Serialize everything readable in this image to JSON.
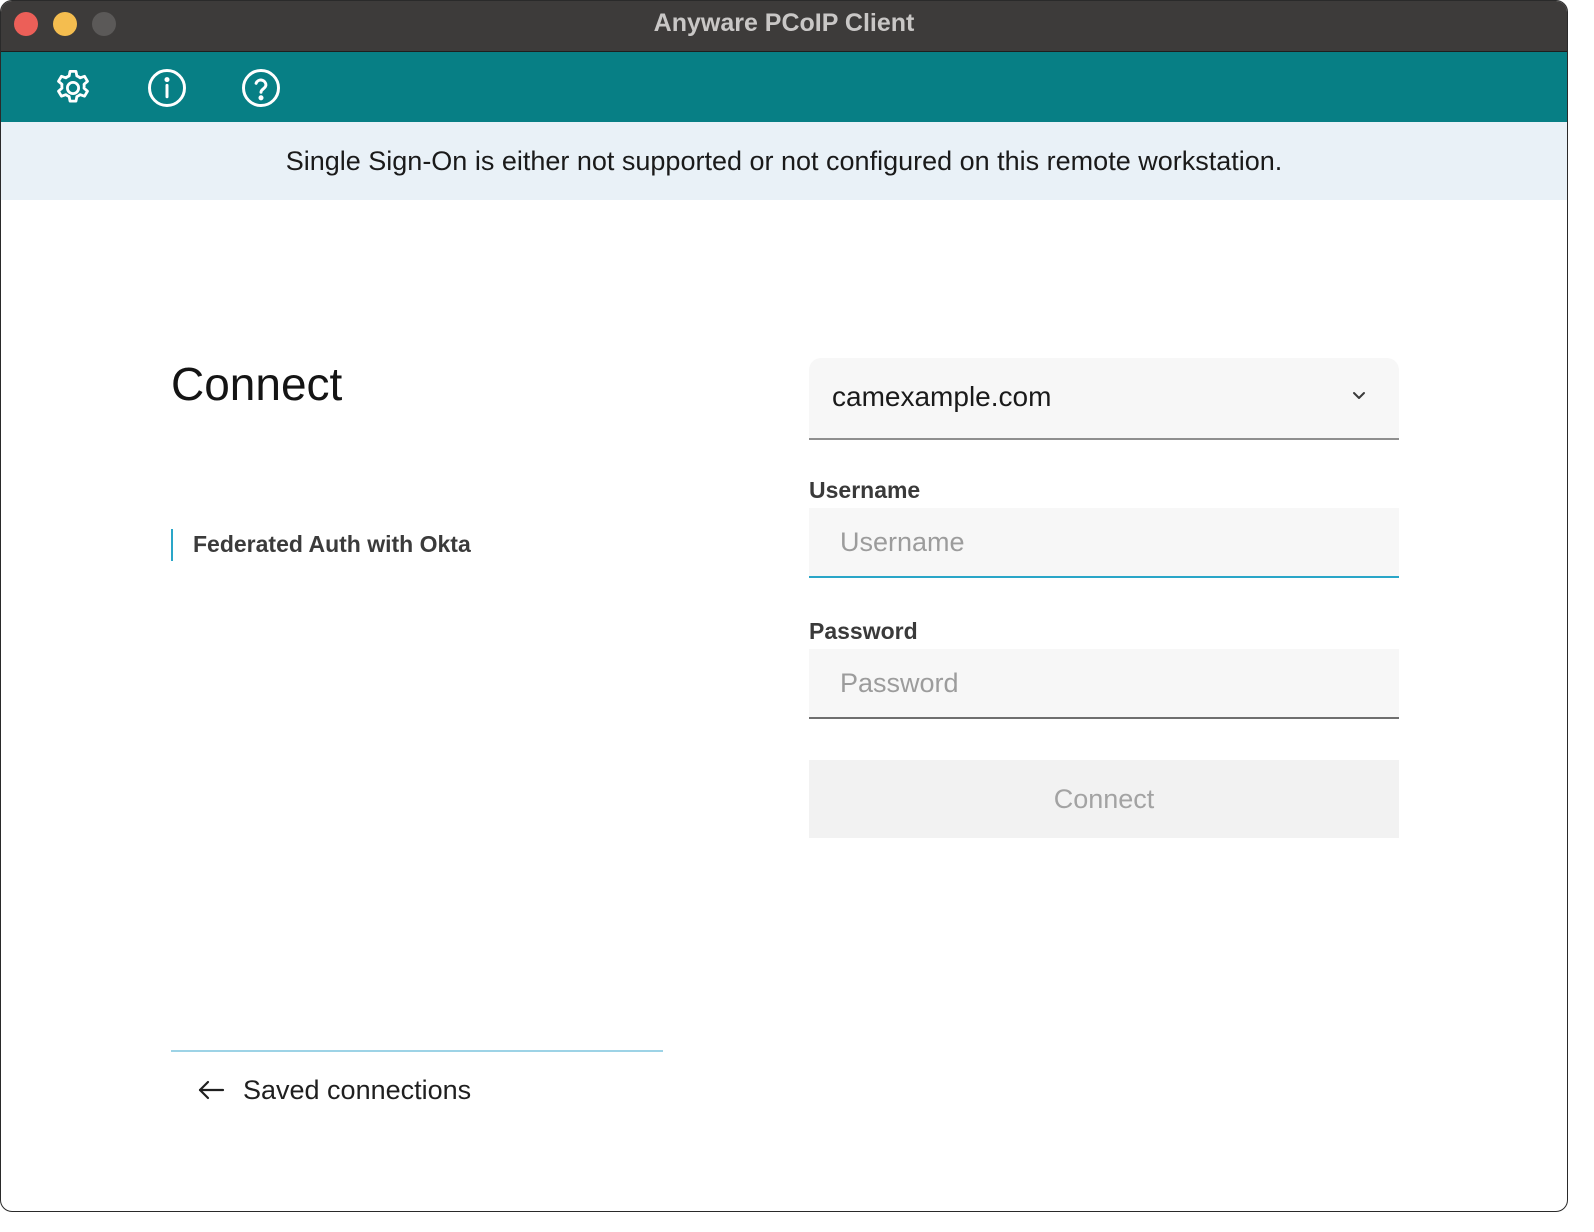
{
  "window": {
    "title": "Anyware PCoIP Client"
  },
  "toolbar": {
    "icons": [
      "gear-icon",
      "info-icon",
      "help-icon"
    ]
  },
  "banner": {
    "message": "Single Sign-On is either not supported or not configured on this remote workstation."
  },
  "main": {
    "title": "Connect",
    "auth_method": "Federated Auth with Okta",
    "saved_connections_label": "Saved connections"
  },
  "form": {
    "domain": "camexample.com",
    "username_label": "Username",
    "username_placeholder": "Username",
    "username_value": "",
    "password_label": "Password",
    "password_placeholder": "Password",
    "password_value": "",
    "connect_label": "Connect"
  },
  "colors": {
    "toolbar": "#077f85",
    "banner": "#e9f1f7",
    "accent": "#2aa6c8",
    "close": "#ec5f58",
    "minimize": "#f4bd4f"
  }
}
